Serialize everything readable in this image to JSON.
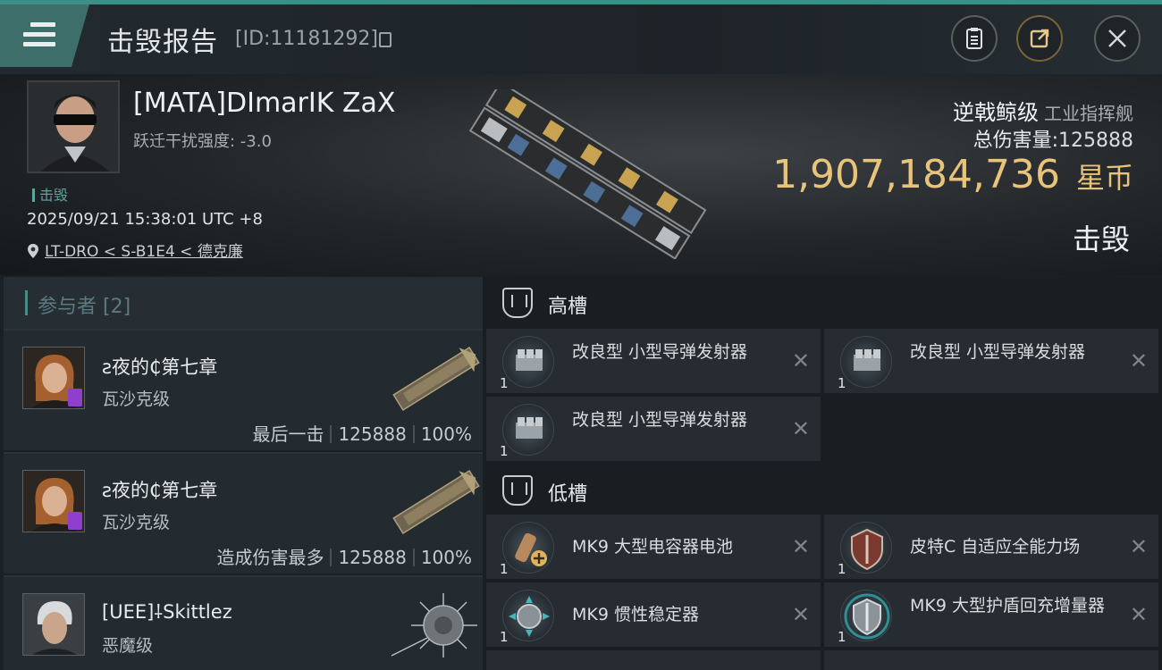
{
  "header": {
    "title": "击毁报告",
    "report_id": "[ID:11181292]"
  },
  "victim": {
    "name": "[MATA]DImarIK ZaX",
    "warp_disrupt": "跃迁干扰强度:  -3.0",
    "tag": "击毁",
    "time": "2025/09/21 15:38:01 UTC +8",
    "location": "LT-DRO < S-B1E4 < 德克廉",
    "ship_class": "逆戟鲸级",
    "ship_role": "工业指挥舰",
    "total_damage_label": "总伤害量:",
    "total_damage": "125888",
    "value": "1,907,184,736",
    "value_unit": "星币",
    "kill_type": "击毁"
  },
  "participants": {
    "label": "参与者 [2]",
    "rows": [
      {
        "name": "ƨ夜的₵第七章",
        "ship": "瓦沙克级",
        "role": "最后一击",
        "damage": "125888",
        "percent": "100%"
      },
      {
        "name": "ƨ夜的₵第七章",
        "ship": "瓦沙克级",
        "role": "造成伤害最多",
        "damage": "125888",
        "percent": "100%"
      },
      {
        "name": "[UEE]⸸Skittlez",
        "ship": "恶魔级"
      }
    ]
  },
  "fittings": {
    "high_label": "高槽",
    "low_label": "低槽",
    "high": [
      {
        "name": "改良型 小型导弹发射器",
        "qty": "1"
      },
      {
        "name": "改良型 小型导弹发射器",
        "qty": "1"
      },
      {
        "name": "改良型 小型导弹发射器",
        "qty": "1"
      }
    ],
    "low": [
      {
        "name": "MK9 大型电容器电池",
        "qty": "1"
      },
      {
        "name": "皮特C 自适应全能力场",
        "qty": "1"
      },
      {
        "name": "MK9 惯性稳定器",
        "qty": "1"
      },
      {
        "name": "MK9 大型护盾回充增量器",
        "qty": "1"
      }
    ],
    "close_glyph": "✕"
  },
  "colors": {
    "accent": "#3b8f86",
    "isk": "#e8c37a",
    "badge": "#8e3fd0"
  }
}
